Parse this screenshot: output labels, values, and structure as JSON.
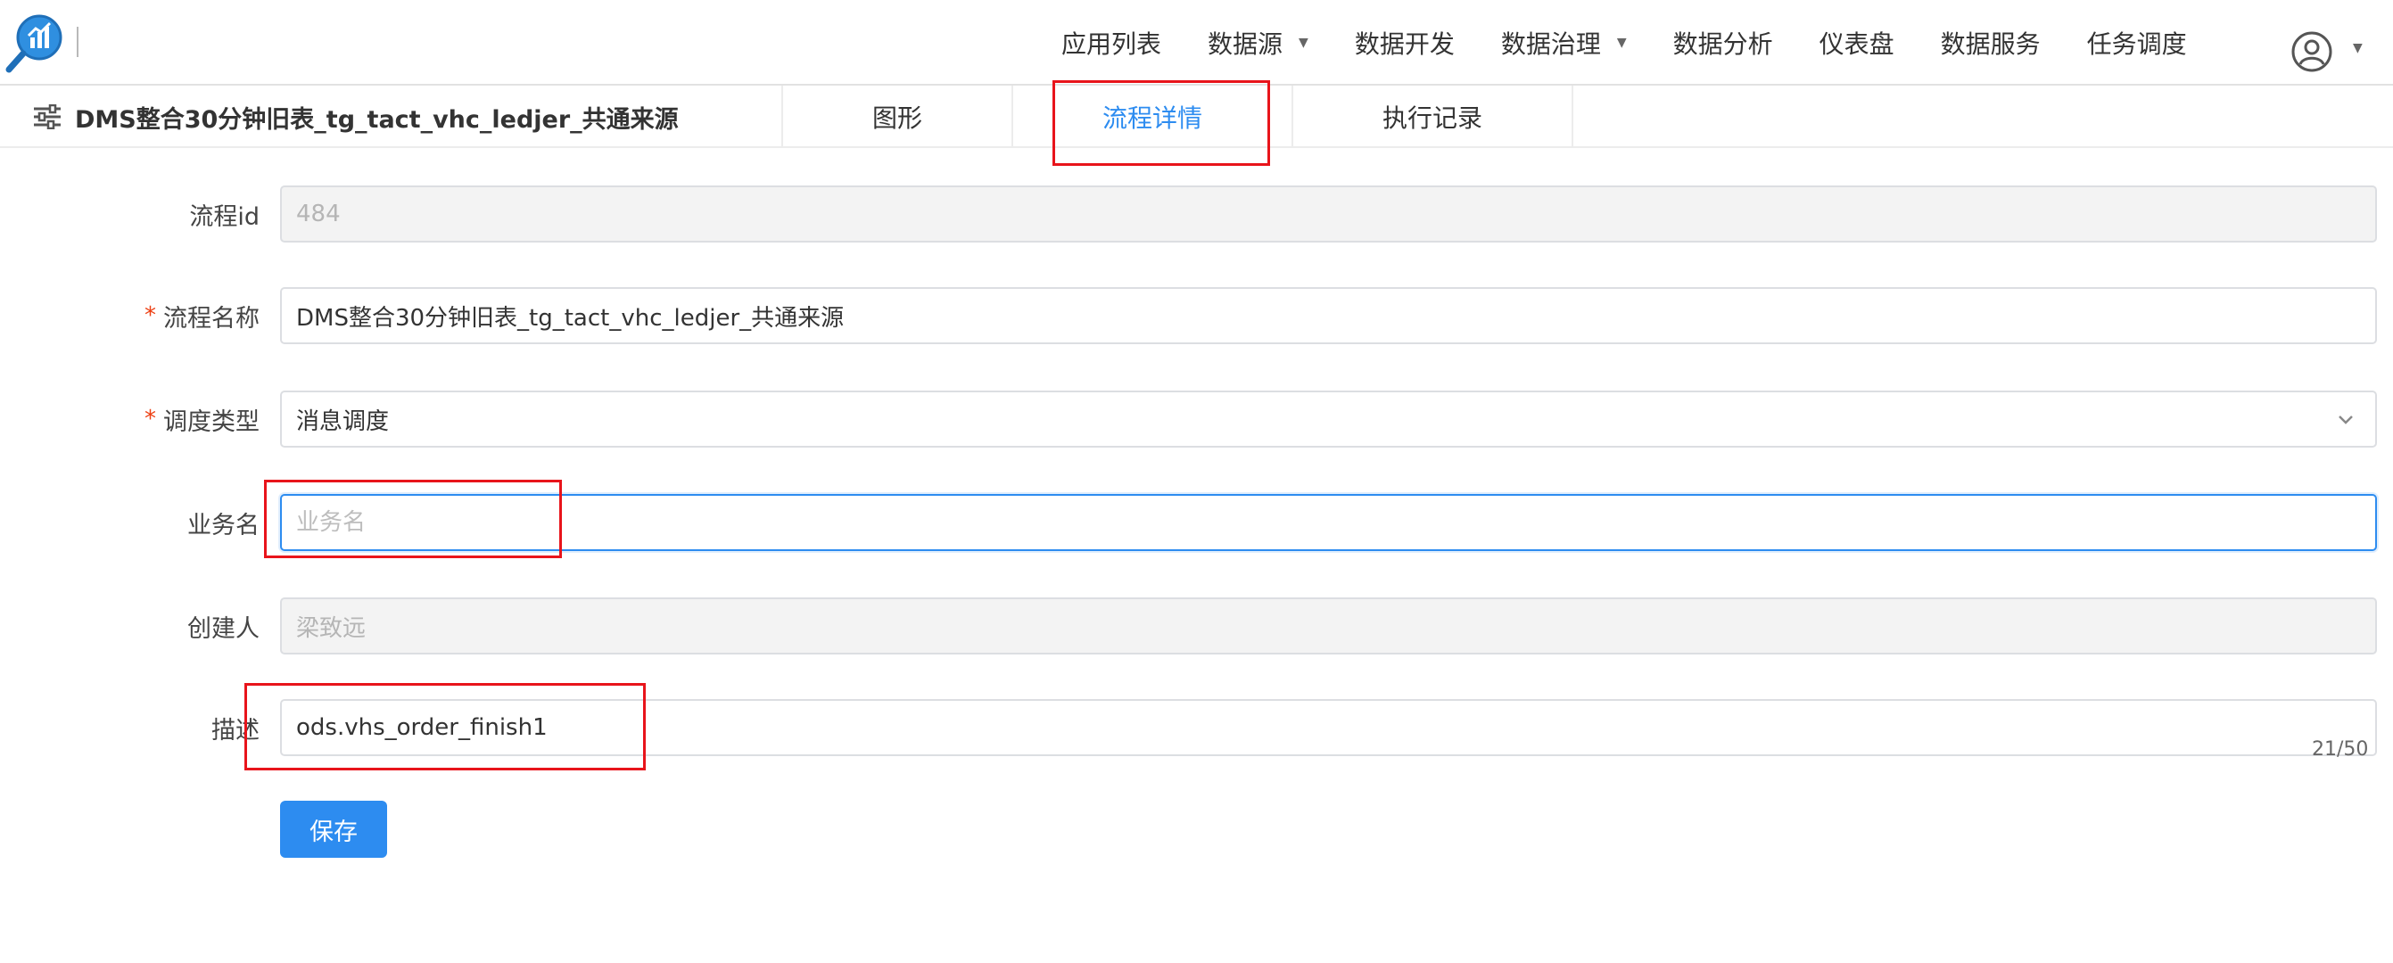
{
  "nav": {
    "items": [
      {
        "label": "应用列表",
        "dropdown": false
      },
      {
        "label": "数据源",
        "dropdown": true
      },
      {
        "label": "数据开发",
        "dropdown": false
      },
      {
        "label": "数据治理",
        "dropdown": true
      },
      {
        "label": "数据分析",
        "dropdown": false
      },
      {
        "label": "仪表盘",
        "dropdown": false
      },
      {
        "label": "数据服务",
        "dropdown": false
      },
      {
        "label": "任务调度",
        "dropdown": false
      }
    ],
    "user_icon": "user-circle-icon"
  },
  "tabs": {
    "flow_title": "DMS整合30分钟旧表_tg_tact_vhc_ledjer_共通来源",
    "items": [
      {
        "label": "图形",
        "active": false
      },
      {
        "label": "流程详情",
        "active": true
      },
      {
        "label": "执行记录",
        "active": false
      }
    ]
  },
  "form": {
    "flow_id": {
      "label": "流程id",
      "value": "484",
      "required": false
    },
    "flow_name": {
      "label": "流程名称",
      "value": "DMS整合30分钟旧表_tg_tact_vhc_ledjer_共通来源",
      "required": true
    },
    "schedule_type": {
      "label": "调度类型",
      "value": "消息调度",
      "required": true
    },
    "business_name": {
      "label": "业务名",
      "value": "",
      "placeholder": "业务名",
      "required": false
    },
    "creator": {
      "label": "创建人",
      "value": "梁致远",
      "required": false
    },
    "description": {
      "label": "描述",
      "value": "ods.vhs_order_finish1",
      "counter": "21/50",
      "required": false
    },
    "save_label": "保存"
  },
  "colors": {
    "accent": "#2d8cf0",
    "required": "#ed4014",
    "annotation": "#e8141b"
  }
}
